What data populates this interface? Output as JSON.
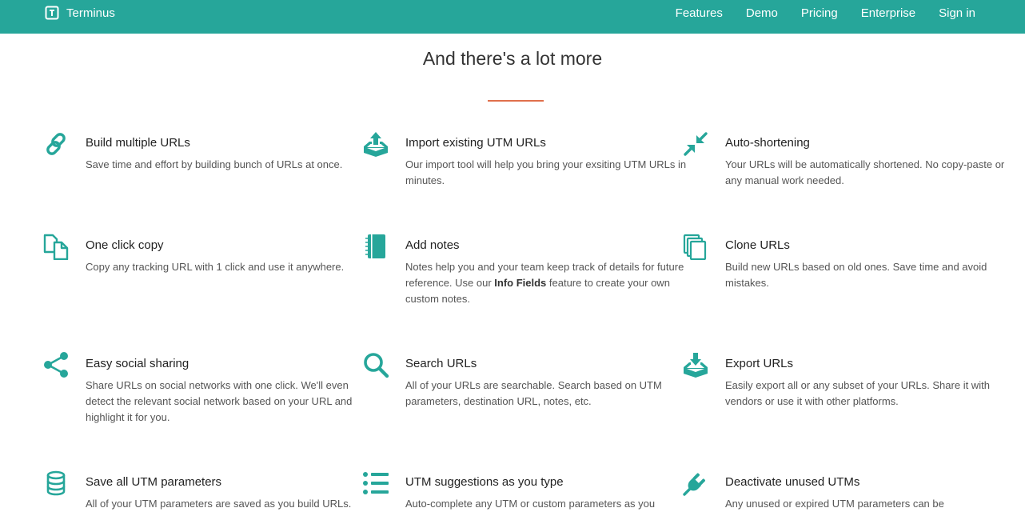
{
  "brand": {
    "name": "Terminus",
    "icon": "terminus-logo-icon"
  },
  "nav": {
    "items": [
      "Features",
      "Demo",
      "Pricing",
      "Enterprise",
      "Sign in"
    ]
  },
  "section": {
    "heading": "And there's a lot more"
  },
  "colors": {
    "accent": "#26a69a",
    "divider": "#e0704c"
  },
  "features": [
    {
      "icon": "link-icon",
      "title": "Build multiple URLs",
      "desc": "Save time and effort by building bunch of URLs at once."
    },
    {
      "icon": "import-icon",
      "title": "Import existing UTM URLs",
      "desc": "Our import tool will help you bring your exsiting UTM URLs in minutes."
    },
    {
      "icon": "compress-icon",
      "title": "Auto-shortening",
      "desc": "Your URLs will be automatically shortened. No copy-paste or any manual work needed."
    },
    {
      "icon": "copy-icon",
      "title": "One click copy",
      "desc": "Copy any tracking URL with 1 click and use it anywhere."
    },
    {
      "icon": "notebook-icon",
      "title": "Add notes",
      "desc_before": "Notes help you and your team keep track of details for future reference. Use our ",
      "desc_bold": "Info Fields",
      "desc_after": " feature to create your own custom notes."
    },
    {
      "icon": "clone-icon",
      "title": "Clone URLs",
      "desc": "Build new URLs based on old ones. Save time and avoid mistakes."
    },
    {
      "icon": "share-icon",
      "title": "Easy social sharing",
      "desc": "Share URLs on social networks with one click. We'll even detect the relevant social network based on your URL and highlight it for you."
    },
    {
      "icon": "search-icon",
      "title": "Search URLs",
      "desc": "All of your URLs are searchable. Search based on UTM parameters, destination URL, notes, etc."
    },
    {
      "icon": "export-icon",
      "title": "Export URLs",
      "desc": "Easily export all or any subset of your URLs. Share it with vendors or use it with other platforms."
    },
    {
      "icon": "database-icon",
      "title": "Save all UTM parameters",
      "desc": "All of your UTM parameters are saved as you build URLs."
    },
    {
      "icon": "list-icon",
      "title": "UTM suggestions as you type",
      "desc": "Auto-complete any UTM or custom parameters as you"
    },
    {
      "icon": "plug-icon",
      "title": "Deactivate unused UTMs",
      "desc": "Any unused or expired UTM parameters can be"
    }
  ]
}
